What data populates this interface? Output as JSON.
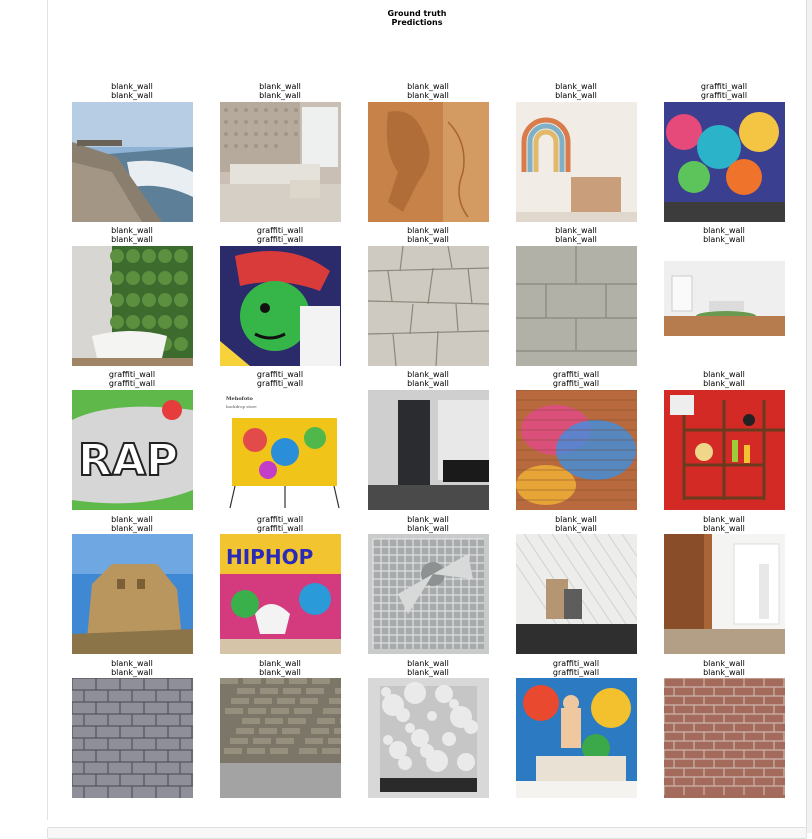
{
  "figure": {
    "title_line1": "Ground truth",
    "title_line2": "Predictions"
  },
  "grid": [
    [
      {
        "truth": "blank_wall",
        "pred": "blank_wall",
        "scene": "seaside-promenade"
      },
      {
        "truth": "blank_wall",
        "pred": "blank_wall",
        "scene": "tufted-headboard-lounge"
      },
      {
        "truth": "blank_wall",
        "pred": "blank_wall",
        "scene": "carved-wood-relief"
      },
      {
        "truth": "blank_wall",
        "pred": "blank_wall",
        "scene": "rainbow-nursery"
      },
      {
        "truth": "graffiti_wall",
        "pred": "graffiti_wall",
        "scene": "colorful-mural"
      }
    ],
    [
      {
        "truth": "blank_wall",
        "pred": "blank_wall",
        "scene": "green-wall-bathroom"
      },
      {
        "truth": "graffiti_wall",
        "pred": "graffiti_wall",
        "scene": "graffiti-face"
      },
      {
        "truth": "blank_wall",
        "pred": "blank_wall",
        "scene": "stone-wall"
      },
      {
        "truth": "blank_wall",
        "pred": "blank_wall",
        "scene": "grey-tiles"
      },
      {
        "truth": "blank_wall",
        "pred": "blank_wall",
        "scene": "white-room"
      }
    ],
    [
      {
        "truth": "graffiti_wall",
        "pred": "graffiti_wall",
        "scene": "graffiti-rap"
      },
      {
        "truth": "graffiti_wall",
        "pred": "graffiti_wall",
        "scene": "graffiti-backdrop",
        "caption1": "Mehofoto",
        "caption2": "backdrop store"
      },
      {
        "truth": "blank_wall",
        "pred": "blank_wall",
        "scene": "dark-doorway"
      },
      {
        "truth": "graffiti_wall",
        "pred": "graffiti_wall",
        "scene": "painted-brick"
      },
      {
        "truth": "blank_wall",
        "pred": "blank_wall",
        "scene": "red-shelf-wall"
      }
    ],
    [
      {
        "truth": "blank_wall",
        "pred": "blank_wall",
        "scene": "great-wall-tower"
      },
      {
        "truth": "graffiti_wall",
        "pred": "graffiti_wall",
        "scene": "graffiti-hiphop-chair"
      },
      {
        "truth": "blank_wall",
        "pred": "blank_wall",
        "scene": "industrial-fan"
      },
      {
        "truth": "blank_wall",
        "pred": "blank_wall",
        "scene": "white-tile-room"
      },
      {
        "truth": "blank_wall",
        "pred": "blank_wall",
        "scene": "wood-panel-hall"
      }
    ],
    [
      {
        "truth": "blank_wall",
        "pred": "blank_wall",
        "scene": "grey-brick"
      },
      {
        "truth": "blank_wall",
        "pred": "blank_wall",
        "scene": "slate-stone-wall"
      },
      {
        "truth": "blank_wall",
        "pred": "blank_wall",
        "scene": "bokeh-backdrop"
      },
      {
        "truth": "graffiti_wall",
        "pred": "graffiti_wall",
        "scene": "graffiti-kid-bed"
      },
      {
        "truth": "blank_wall",
        "pred": "blank_wall",
        "scene": "red-brick"
      }
    ]
  ]
}
